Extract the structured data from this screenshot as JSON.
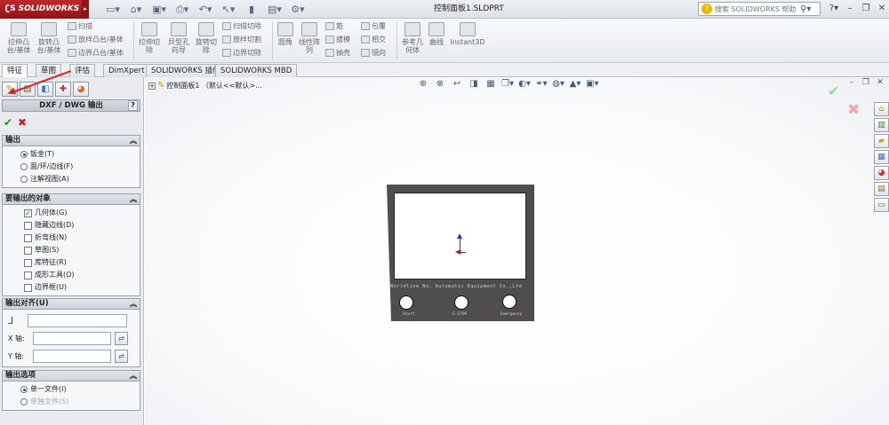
{
  "app": {
    "logo": "SOLIDWORKS",
    "doc_title": "控制面板1.SLDPRT",
    "help_placeholder": "搜索 SOLIDWORKS 帮助"
  },
  "qat_icons": [
    "new-icon",
    "open-icon",
    "save-icon",
    "print-icon",
    "undo-icon",
    "select-icon",
    "rebuild-icon",
    "file-props-icon",
    "options-icon"
  ],
  "ribbon": {
    "extrude_boss": "拉伸凸\n台/基体",
    "revolve_boss": "旋转凸\n台/基体",
    "sweep": "扫描",
    "loft_boss": "放样凸台/基体",
    "boundary_boss": "边界凸台/基体",
    "extrude_cut": "拉伸切\n除",
    "hole_wizard": "异型孔\n向导",
    "revolve_cut": "旋转切\n除",
    "sweep_cut": "扫描切除",
    "loft_cut": "放样切割",
    "boundary_cut": "边界切除",
    "fillet": "圆角",
    "linear_pattern": "线性阵\n列",
    "rib": "筋",
    "draft": "拔模",
    "shell": "抽壳",
    "wrap": "包覆",
    "intersect": "相交",
    "mirror": "镜向",
    "ref_geometry": "参考几\n何体",
    "curves": "曲线",
    "instant3d": "Instant3D"
  },
  "tabs": [
    "特征",
    "草图",
    "评估",
    "DimXpert",
    "SOLIDWORKS 插件",
    "SOLIDWORKS MBD"
  ],
  "pm": {
    "title": "DXF / DWG 输出",
    "help": "?",
    "ok": "✔",
    "cancel": "✖"
  },
  "output": {
    "header": "输出",
    "options": [
      {
        "label": "钣金(T)",
        "selected": true
      },
      {
        "label": "面/环/边线(F)",
        "selected": false
      },
      {
        "label": "注解视图(A)",
        "selected": false
      }
    ]
  },
  "objects": {
    "header": "要输出的对象",
    "items": [
      {
        "label": "几何体(G)",
        "checked": true
      },
      {
        "label": "隐藏边线(D)",
        "checked": false
      },
      {
        "label": "折弯线(N)",
        "checked": false
      },
      {
        "label": "草图(S)",
        "checked": false
      },
      {
        "label": "库特征(R)",
        "checked": false
      },
      {
        "label": "成形工具(O)",
        "checked": false
      },
      {
        "label": "边界框(U)",
        "checked": false
      }
    ]
  },
  "align": {
    "header": "输出对齐(U)",
    "x_label": "X 轴:",
    "y_label": "Y 轴:",
    "origin_value": "",
    "x_value": "",
    "y_value": ""
  },
  "options": {
    "header": "输出选项",
    "items": [
      {
        "label": "单一文件(I)",
        "selected": true,
        "disabled": false
      },
      {
        "label": "单独文件(S)",
        "selected": false,
        "disabled": true
      }
    ]
  },
  "tree": {
    "part": "控制面板1 （默认<<默认>..."
  },
  "part": {
    "engraving": "Worldline No. Automatic Equipment Co.,Ltd",
    "hole_labels": [
      "Start",
      "E-STOP",
      "Emergency"
    ]
  }
}
